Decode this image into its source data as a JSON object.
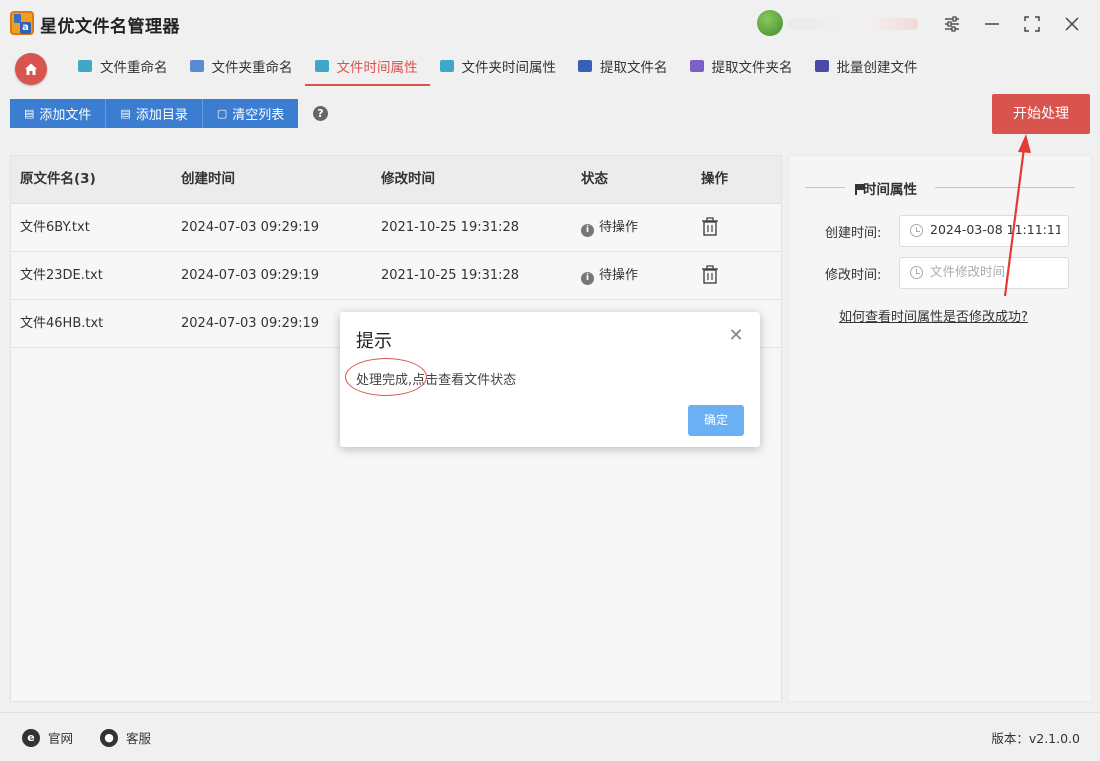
{
  "app": {
    "title": "星优文件名管理器"
  },
  "tabs": [
    {
      "label": "文件重命名",
      "icon": "rename-file-icon",
      "color": "#3fa7c8"
    },
    {
      "label": "文件夹重命名",
      "icon": "rename-folder-icon",
      "color": "#5a8ad0"
    },
    {
      "label": "文件时间属性",
      "icon": "file-time-icon",
      "color": "#3fa7c8",
      "active": true
    },
    {
      "label": "文件夹时间属性",
      "icon": "folder-time-icon",
      "color": "#3fa7c8"
    },
    {
      "label": "提取文件名",
      "icon": "extract-filename-icon",
      "color": "#3a5fb8"
    },
    {
      "label": "提取文件夹名",
      "icon": "extract-foldername-icon",
      "color": "#7a5fc8"
    },
    {
      "label": "批量创建文件",
      "icon": "batch-create-icon",
      "color": "#4a4aa8"
    }
  ],
  "toolbar": {
    "add_file": "添加文件",
    "add_dir": "添加目录",
    "clear_list": "清空列表",
    "start": "开始处理"
  },
  "table": {
    "headers": [
      "原文件名(3)",
      "创建时间",
      "修改时间",
      "状态",
      "操作"
    ],
    "rows": [
      {
        "name": "文件6BY.txt",
        "created": "2024-07-03 09:29:19",
        "modified": "2021-10-25 19:31:28",
        "status": "待操作"
      },
      {
        "name": "文件23DE.txt",
        "created": "2024-07-03 09:29:19",
        "modified": "2021-10-25 19:31:28",
        "status": "待操作"
      },
      {
        "name": "文件46HB.txt",
        "created": "2024-07-03 09:29:19",
        "modified": "",
        "status": ""
      }
    ]
  },
  "time_props": {
    "title": "时间属性",
    "created_label": "创建时间:",
    "created_value": "2024-03-08 11:11:11",
    "modified_label": "修改时间:",
    "modified_placeholder": "文件修改时间",
    "help_link": "如何查看时间属性是否修改成功?"
  },
  "statusbar": {
    "website": "官网",
    "support": "客服",
    "version": "版本：v2.1.0.0"
  },
  "dialog": {
    "title": "提示",
    "message_highlight": "处理完成,",
    "message_rest": "点击查看文件状态",
    "ok": "确定"
  },
  "colors": {
    "accent": "#d9534f",
    "primary": "#3a7dd1",
    "ok_button": "#6ab0f3"
  }
}
